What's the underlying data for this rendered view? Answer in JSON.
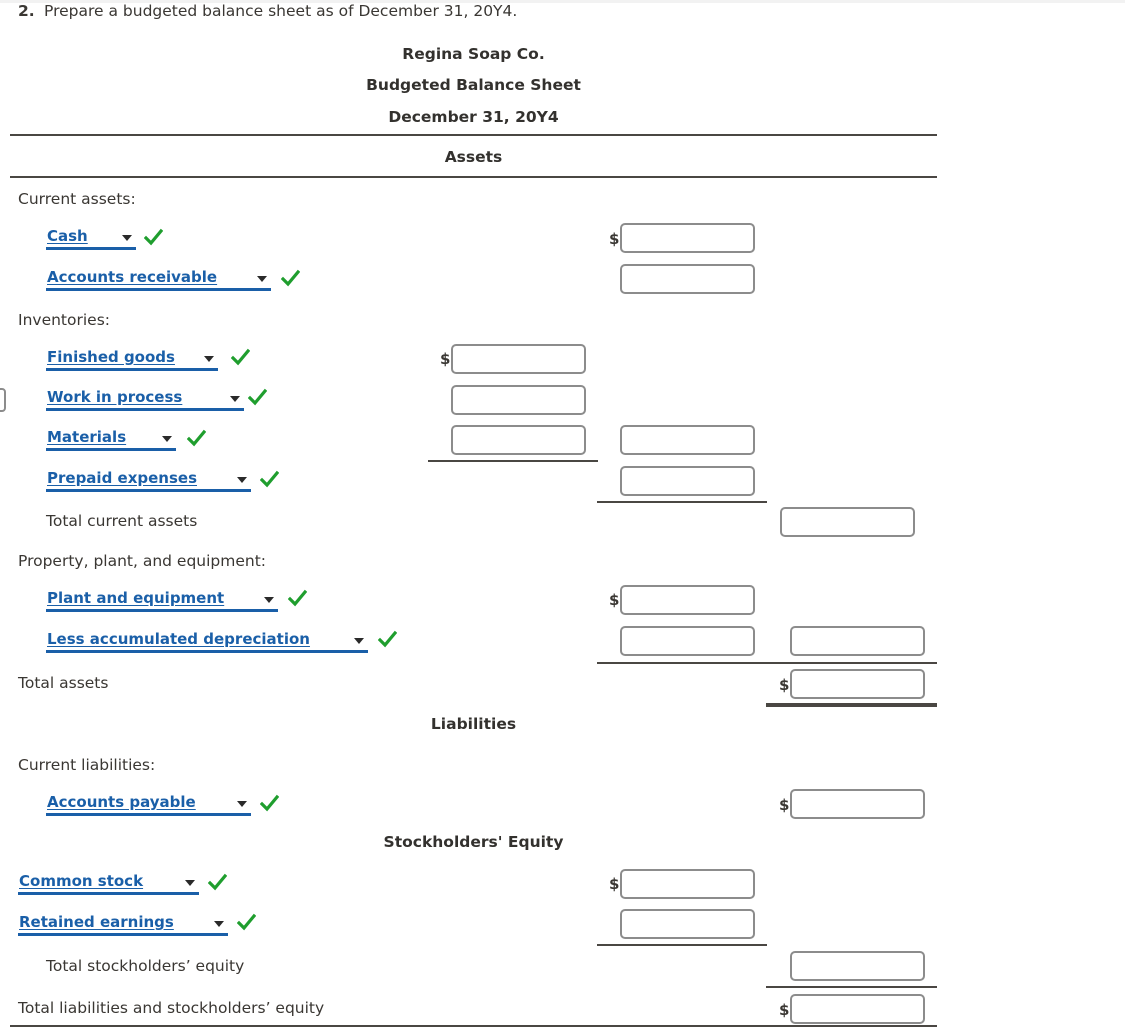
{
  "question": {
    "number": "2.",
    "text": "Prepare a budgeted balance sheet as of December 31, 20Y4."
  },
  "statement": {
    "company": "Regina Soap Co.",
    "title": "Budgeted Balance Sheet",
    "date": "December 31, 20Y4"
  },
  "sections": {
    "assets_caption": "Assets",
    "liabilities_caption": "Liabilities",
    "equity_caption": "Stockholders' Equity"
  },
  "labels": {
    "current_assets": "Current assets:",
    "inventories": "Inventories:",
    "total_current_assets": "Total current assets",
    "ppe": "Property, plant, and equipment:",
    "total_assets": "Total assets",
    "current_liabilities": "Current liabilities:",
    "total_stockholders_equity": "Total stockholders’ equity",
    "total_liab_equity": "Total liabilities and stockholders’ equity"
  },
  "dropdowns": [
    {
      "id": "cash",
      "value": "Cash",
      "checked": true
    },
    {
      "id": "accounts-receivable",
      "value": "Accounts receivable",
      "checked": true
    },
    {
      "id": "finished-goods",
      "value": "Finished goods",
      "checked": true
    },
    {
      "id": "work-in-process",
      "value": "Work in process",
      "checked": true
    },
    {
      "id": "materials",
      "value": "Materials",
      "checked": true
    },
    {
      "id": "prepaid-expenses",
      "value": "Prepaid expenses",
      "checked": true
    },
    {
      "id": "plant-and-equipment",
      "value": "Plant and equipment",
      "checked": true
    },
    {
      "id": "less-accumulated-depreciation",
      "value": "Less accumulated depreciation",
      "checked": true
    },
    {
      "id": "accounts-payable",
      "value": "Accounts payable",
      "checked": true
    },
    {
      "id": "common-stock",
      "value": "Common stock",
      "checked": true
    },
    {
      "id": "retained-earnings",
      "value": "Retained earnings",
      "checked": true
    }
  ],
  "amount_inputs": [
    {
      "id": "cash-amount",
      "column": 2,
      "value": "",
      "dollar": "$"
    },
    {
      "id": "accounts-receivable-amount",
      "column": 2,
      "value": "",
      "dollar": ""
    },
    {
      "id": "finished-goods-amount",
      "column": 1,
      "value": "",
      "dollar": "$"
    },
    {
      "id": "work-in-process-amount",
      "column": 1,
      "value": "",
      "dollar": ""
    },
    {
      "id": "materials-amount",
      "column": 1,
      "value": "",
      "dollar": ""
    },
    {
      "id": "inventories-total-amount",
      "column": 2,
      "value": "",
      "dollar": ""
    },
    {
      "id": "prepaid-expenses-amount",
      "column": 2,
      "value": "",
      "dollar": ""
    },
    {
      "id": "total-current-assets-amount",
      "column": 3,
      "value": "",
      "dollar": ""
    },
    {
      "id": "plant-and-equipment-amount",
      "column": 2,
      "value": "",
      "dollar": "$"
    },
    {
      "id": "less-accumulated-depreciation-amount",
      "column": 2,
      "value": "",
      "dollar": ""
    },
    {
      "id": "net-ppe-amount",
      "column": 3,
      "value": "",
      "dollar": ""
    },
    {
      "id": "total-assets-amount",
      "column": 3,
      "value": "",
      "dollar": "$"
    },
    {
      "id": "accounts-payable-amount",
      "column": 3,
      "value": "",
      "dollar": "$"
    },
    {
      "id": "common-stock-amount",
      "column": 2,
      "value": "",
      "dollar": "$"
    },
    {
      "id": "retained-earnings-amount",
      "column": 2,
      "value": "",
      "dollar": ""
    },
    {
      "id": "total-stockholders-equity-amount",
      "column": 3,
      "value": "",
      "dollar": ""
    },
    {
      "id": "total-liabilities-equity-amount",
      "column": 3,
      "value": "",
      "dollar": "$"
    }
  ],
  "icons": {
    "check": "check-icon",
    "dropdown_arrow": "chevron-down-icon"
  },
  "colors": {
    "dropdown_text": "#1a5fa8",
    "check_green": "#1f9e2e",
    "rule": "#4a4743",
    "input_border": "#8c8c8c",
    "body_text": "#3a3733"
  }
}
